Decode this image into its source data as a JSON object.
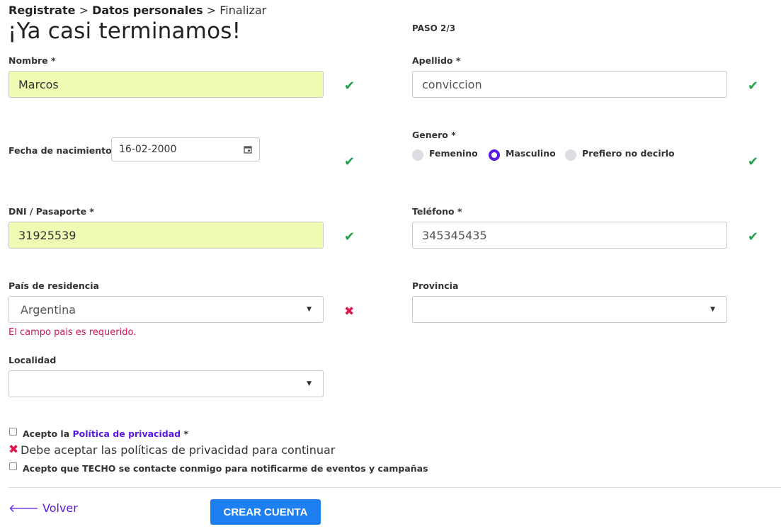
{
  "breadcrumb": {
    "step1": "Registrate",
    "sep1": ">",
    "step2": "Datos personales",
    "sep2": ">",
    "step3": "Finalizar"
  },
  "page_title": "¡Ya casi terminamos!",
  "step_indicator": "PASO 2/3",
  "fields": {
    "nombre": {
      "label": "Nombre *",
      "value": "Marcos",
      "status": "valid"
    },
    "apellido": {
      "label": "Apellido *",
      "value": "conviccion",
      "status": "valid"
    },
    "fecha": {
      "label": "Fecha de nacimiento *",
      "value": "16-02-2000",
      "status": "valid"
    },
    "genero": {
      "label": "Genero *",
      "options": [
        "Femenino",
        "Masculino",
        "Prefiero no decirlo"
      ],
      "selected": "Masculino",
      "status": "valid"
    },
    "dni": {
      "label": "DNI / Pasaporte *",
      "value": "31925539",
      "status": "valid"
    },
    "telefono": {
      "label": "Teléfono *",
      "value": "345345435",
      "status": "valid"
    },
    "pais": {
      "label": "País de residencia",
      "value": "Argentina",
      "status": "invalid",
      "error": "El campo pais es requerido."
    },
    "provincia": {
      "label": "Provincia",
      "value": ""
    },
    "localidad": {
      "label": "Localidad",
      "value": ""
    }
  },
  "privacy": {
    "prefix": "Acepto la",
    "link": "Política de privacidad",
    "suffix": "*",
    "checked": false,
    "error": "Debe aceptar las políticas de privacidad para continuar"
  },
  "contact_consent": {
    "label": "Acepto que TECHO se contacte conmigo para notificarme de eventos y campañas",
    "checked": false
  },
  "actions": {
    "back": "Volver",
    "submit": "CREAR CUENTA"
  },
  "colors": {
    "accent": "#5a18e6",
    "button": "#1e7ff0",
    "valid": "#22a14a",
    "error": "#e0174a",
    "valid_fill": "#eefcb3"
  },
  "icons": {
    "valid": "check-icon",
    "invalid": "x-icon",
    "back": "arrow-left-icon",
    "calendar": "calendar-icon",
    "dropdown": "caret-down-icon"
  }
}
